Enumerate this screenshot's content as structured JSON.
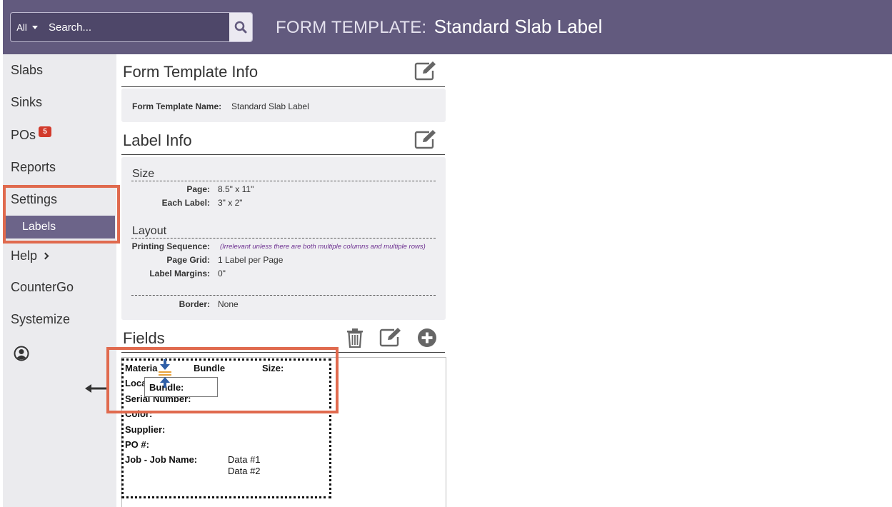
{
  "header": {
    "search_scope": "All",
    "search_placeholder": "Search...",
    "page_title_prefix": "FORM TEMPLATE:",
    "page_title_name": "Standard Slab Label",
    "colors": {
      "header_bg": "#625a7e",
      "search_bg": "#4e4769"
    }
  },
  "sidebar": {
    "items": [
      {
        "label": "Slabs"
      },
      {
        "label": "Sinks"
      },
      {
        "label": "POs",
        "badge": "5"
      },
      {
        "label": "Reports"
      },
      {
        "label": "Settings"
      },
      {
        "label": "Help"
      },
      {
        "label": "CounterGo"
      },
      {
        "label": "Systemize"
      }
    ],
    "sub_item": "Labels",
    "user_icon": "user-circle-icon"
  },
  "form_template_info": {
    "title": "Form Template Info",
    "name_label": "Form Template Name:",
    "name_value": "Standard Slab Label"
  },
  "label_info": {
    "title": "Label Info",
    "size_title": "Size",
    "page_label": "Page:",
    "page_value": "8.5\" x 11\"",
    "each_label_label": "Each Label:",
    "each_label_value": "3\" x 2\"",
    "layout_title": "Layout",
    "printing_sequence_label": "Printing Sequence:",
    "printing_sequence_note": "(Irrelevant unless there are both multiple columns and multiple rows)",
    "page_grid_label": "Page Grid:",
    "page_grid_value": "1 Label per Page",
    "label_margins_label": "Label Margins:",
    "label_margins_value": "0\"",
    "border_label": "Border:",
    "border_value": "None"
  },
  "fields": {
    "title": "Fields",
    "canvas": {
      "material": "Materia",
      "bundle": "Bundle",
      "size": "Size:",
      "location": "Loca",
      "serial_number": "Serial Number:",
      "color": "Color:",
      "supplier": "Supplier:",
      "po": "PO #:",
      "job": "Job - Job Name:",
      "data1": "Data #1",
      "data2": "Data #2"
    },
    "drag_tooltip": "Bundle:"
  },
  "accent": {
    "highlight": "#e06a4e",
    "badge": "#d23a2c",
    "sub_item_bg": "#6c6489"
  }
}
